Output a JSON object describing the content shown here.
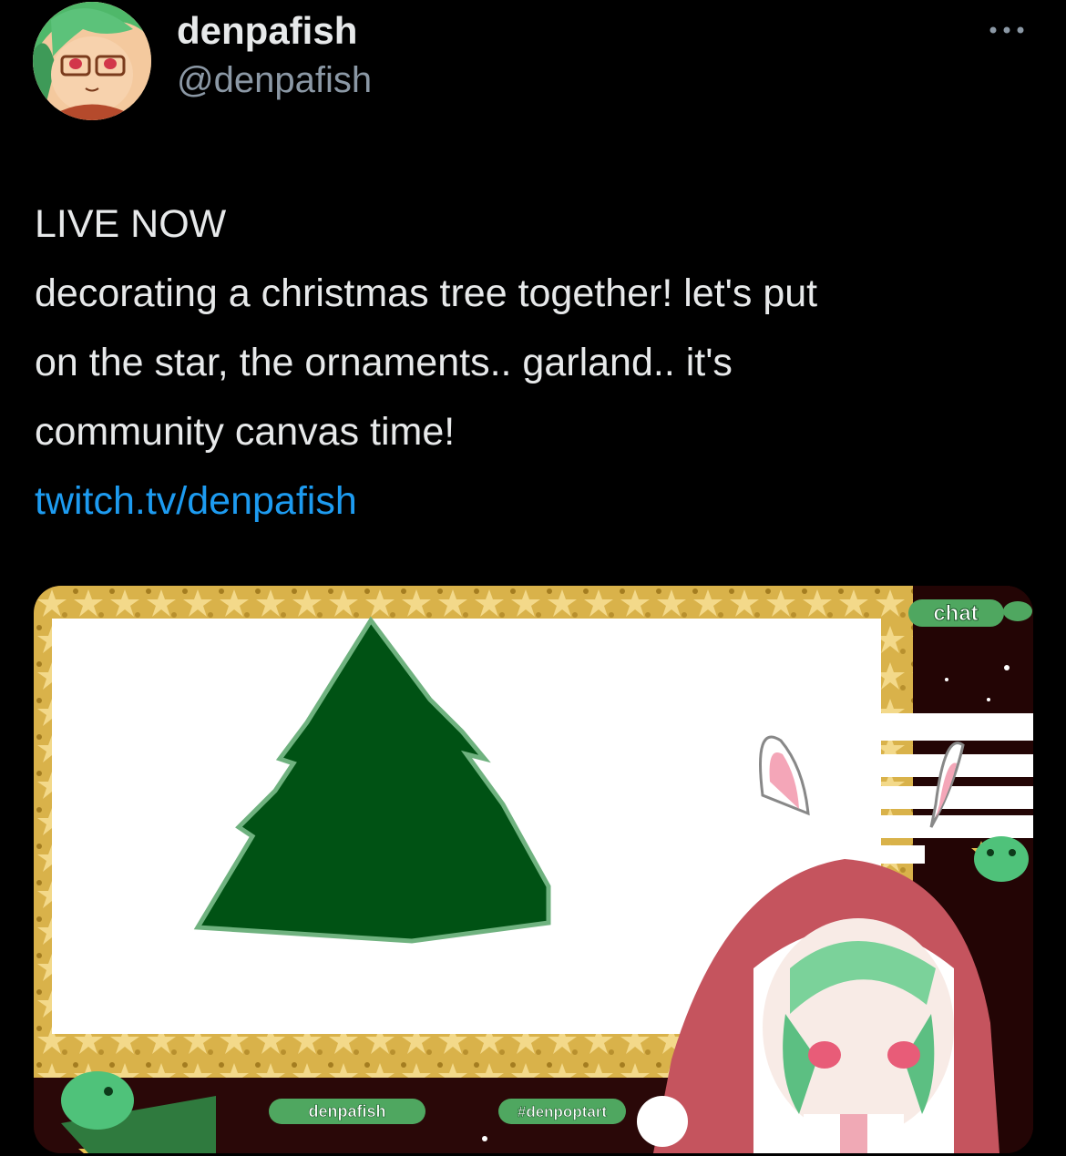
{
  "author": {
    "display_name": "denpafish",
    "handle": "@denpafish"
  },
  "post": {
    "line1": "LIVE NOW",
    "line2": "decorating a christmas tree together! let's put",
    "line3": "on the star, the ornaments.. garland.. it's",
    "line4": "community canvas time!",
    "link": "twitch.tv/denpafish"
  },
  "media": {
    "chat_label": "chat",
    "left_tag": "denpafish",
    "right_tag": "#denpoptart"
  },
  "icons": {
    "more": "more-options-icon"
  },
  "colors": {
    "background": "#000000",
    "text": "#e7e9ea",
    "muted": "#8b98a5",
    "link": "#1d9bf0",
    "tree": "#005214",
    "frame_gold": "#d9b24a",
    "tag_green": "#4fa760"
  }
}
